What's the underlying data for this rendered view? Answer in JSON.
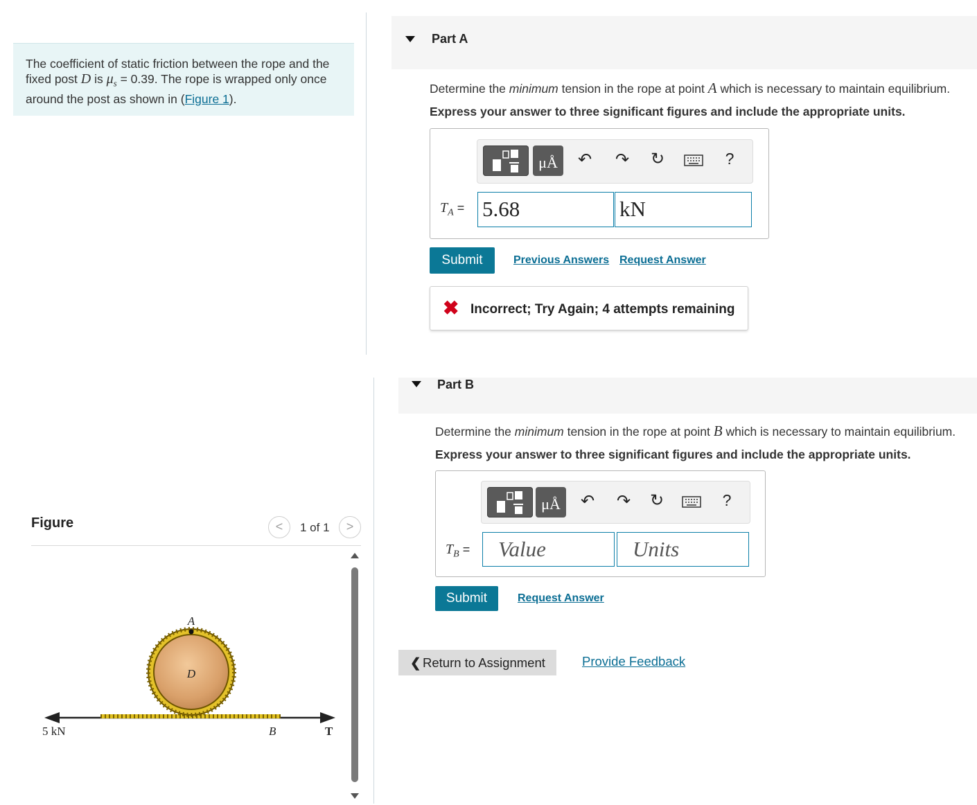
{
  "problem": {
    "text_1": "The coefficient of static friction between the rope and the fixed post ",
    "post_var": "D",
    "text_2": " is ",
    "mu_var": "μ",
    "mu_sub": "s",
    "text_3": " = 0.39. The rope is wrapped only once around the post as shown in (",
    "figure_link": "Figure 1",
    "text_4": ")."
  },
  "part_a": {
    "title": "Part A",
    "question_1": "Determine the ",
    "question_em": "minimum",
    "question_2": " tension in the rope at point ",
    "question_var": "A",
    "question_3": " which is necessary to maintain equilibrium.",
    "instruction": "Express your answer to three significant figures and include the appropriate units.",
    "label_var": "T",
    "label_sub": "A",
    "label_eq": " =",
    "value": "5.68",
    "units": "kN",
    "submit": "Submit",
    "previous_answers": "Previous Answers",
    "request_answer": "Request Answer",
    "feedback": "Incorrect; Try Again; 4 attempts remaining"
  },
  "part_b": {
    "title": "Part B",
    "question_1": "Determine the ",
    "question_em": "minimum",
    "question_2": " tension in the rope at point ",
    "question_var": "B",
    "question_3": " which is necessary to maintain equilibrium.",
    "instruction": "Express your answer to three significant figures and include the appropriate units.",
    "label_var": "T",
    "label_sub": "B",
    "label_eq": " =",
    "value_placeholder": "Value",
    "units_placeholder": "Units",
    "submit": "Submit",
    "request_answer": "Request Answer"
  },
  "toolbar": {
    "units_button": "μÅ",
    "help": "?"
  },
  "footer": {
    "return": "Return to Assignment",
    "provide_feedback": "Provide Feedback"
  },
  "figure": {
    "title": "Figure",
    "pager": "1 of 1",
    "labels": {
      "a": "A",
      "d": "D",
      "load": "5 kN",
      "b": "B",
      "t": "T"
    }
  },
  "colors": {
    "accent": "#0b7896",
    "link": "#0b6e94",
    "error": "#d0021b",
    "problem_bg": "#e8f5f6"
  }
}
